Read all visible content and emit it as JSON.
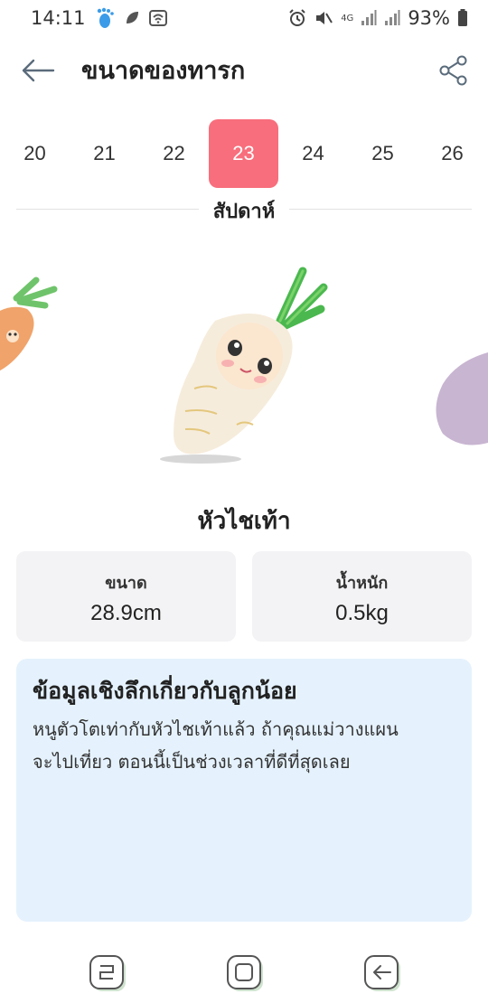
{
  "status_bar": {
    "time": "14:11",
    "battery": "93%",
    "network": "4G"
  },
  "header": {
    "title": "ขนาดของทารก",
    "back_icon": "arrow-left-icon",
    "share_icon": "share-icon"
  },
  "weeks": {
    "items": [
      "20",
      "21",
      "22",
      "23",
      "24",
      "25",
      "26"
    ],
    "selected": "23",
    "label": "สัปดาห์"
  },
  "fruit": {
    "name": "หัวไชเท้า"
  },
  "stats": {
    "size_label": "ขนาด",
    "size_value": "28.9cm",
    "weight_label": "น้ำหนัก",
    "weight_value": "0.5kg"
  },
  "insight": {
    "title": "ข้อมูลเชิงลึกเกี่ยวกับลูกน้อย",
    "line1": "หนูตัวโตเท่ากับหัวไชเท้าแล้ว ถ้าคุณแม่วางแผน",
    "line2": "จะไปเที่ยว ตอนนี้เป็นช่วงเวลาที่ดีที่สุดเลย"
  },
  "colors": {
    "accent": "#f86e7c",
    "insight_bg": "#e5f2fd",
    "card_bg": "#f3f3f5"
  }
}
